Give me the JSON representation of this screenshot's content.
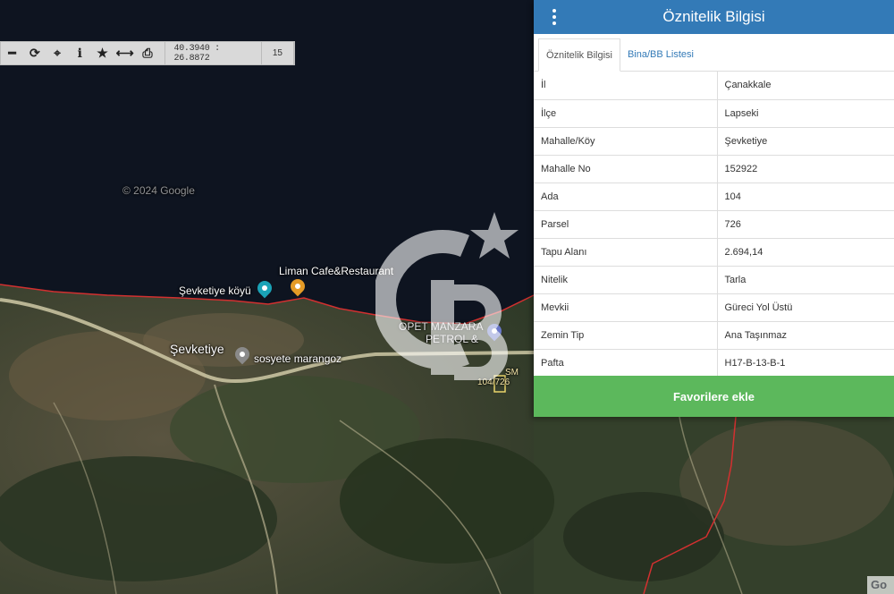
{
  "toolbar": {
    "buttons": [
      {
        "name": "zoom-out",
        "glyph": "━"
      },
      {
        "name": "refresh",
        "glyph": "⟳"
      },
      {
        "name": "locate",
        "glyph": "⌖"
      },
      {
        "name": "info",
        "glyph": "i"
      },
      {
        "name": "favorite",
        "glyph": "★"
      },
      {
        "name": "measure",
        "glyph": "⟷"
      },
      {
        "name": "print",
        "glyph": "⎙"
      }
    ],
    "coords": "40.3940 : 26.8872",
    "zoom": "15"
  },
  "map": {
    "labels": {
      "cafe": "Liman Cafe&Restaurant",
      "koyu": "Şevketiye köyü",
      "village": "Şevketiye",
      "marangoz": "sosyete marangoz",
      "opet_line1": "OPET MANZARA",
      "opet_line2": "PETROL &",
      "parcel": "104/726",
      "sm": "SM",
      "faint": "© 2024 Google"
    },
    "google_logo": "Go"
  },
  "panel": {
    "title": "Öznitelik Bilgisi",
    "tabs": [
      {
        "label": "Öznitelik Bilgisi",
        "active": true
      },
      {
        "label": "Bina/BB Listesi",
        "active": false
      }
    ],
    "rows": [
      {
        "key": "İl",
        "value": "Çanakkale"
      },
      {
        "key": "İlçe",
        "value": "Lapseki"
      },
      {
        "key": "Mahalle/Köy",
        "value": "Şevketiye"
      },
      {
        "key": "Mahalle No",
        "value": "152922"
      },
      {
        "key": "Ada",
        "value": "104"
      },
      {
        "key": "Parsel",
        "value": "726"
      },
      {
        "key": "Tapu Alanı",
        "value": "2.694,14"
      },
      {
        "key": "Nitelik",
        "value": "Tarla"
      },
      {
        "key": "Mevkii",
        "value": "Güreci Yol Üstü"
      },
      {
        "key": "Zemin Tip",
        "value": "Ana Taşınmaz"
      },
      {
        "key": "Pafta",
        "value": "H17-B-13-B-1"
      }
    ],
    "favorite_button": "Favorilere ekle"
  },
  "colors": {
    "header": "#337ab7",
    "favorite": "#5cb85c",
    "boundary": "#d23030",
    "sea": "#0e1420"
  }
}
